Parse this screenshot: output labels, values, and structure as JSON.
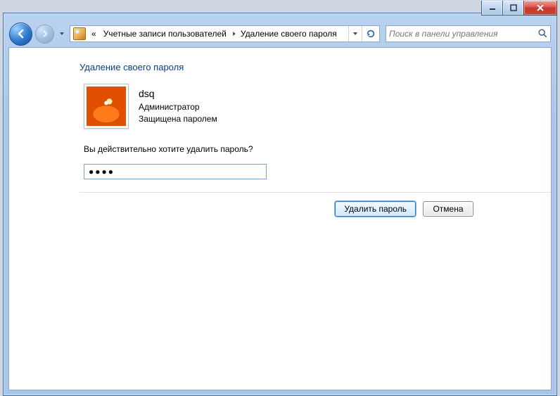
{
  "titlebar": {
    "minimize_name": "minimize",
    "maximize_name": "maximize",
    "close_name": "close"
  },
  "nav": {
    "back_name": "back",
    "forward_name": "forward",
    "history_name": "recent-pages"
  },
  "address": {
    "prefix_glyph": "«",
    "crumb1": "Учетные записи пользователей",
    "crumb2": "Удаление своего пароля",
    "refresh_name": "refresh"
  },
  "search": {
    "placeholder": "Поиск в панели управления",
    "icon_name": "search"
  },
  "page": {
    "title": "Удаление своего пароля",
    "user_name": "dsq",
    "user_role": "Администратор",
    "user_protection": "Защищена паролем",
    "confirm_question": "Вы действительно хотите удалить пароль?",
    "password_value": "●●●●"
  },
  "buttons": {
    "delete": "Удалить пароль",
    "cancel": "Отмена"
  }
}
